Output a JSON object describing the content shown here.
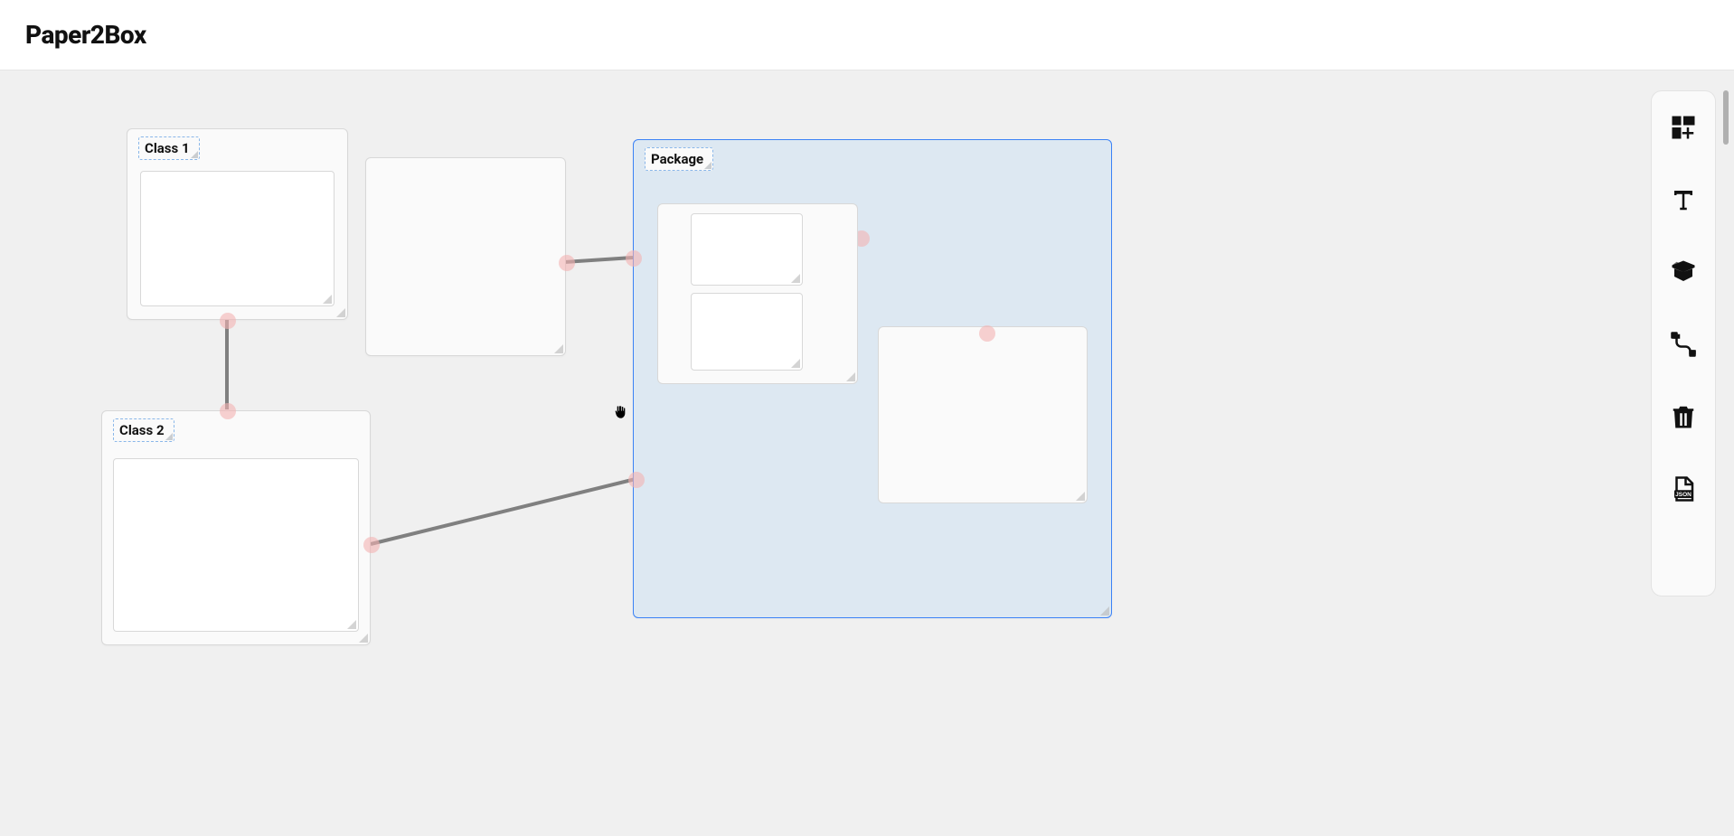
{
  "header": {
    "title": "Paper2Box"
  },
  "nodes": {
    "class1": {
      "label": "Class 1"
    },
    "class2": {
      "label": "Class 2"
    },
    "package": {
      "label": "Package"
    }
  },
  "toolbar": {
    "items": [
      {
        "name": "add-widget-tool",
        "icon": "widgets-add-icon"
      },
      {
        "name": "text-tool",
        "icon": "text-icon"
      },
      {
        "name": "package-tool",
        "icon": "open-box-icon"
      },
      {
        "name": "connector-tool",
        "icon": "cable-icon"
      },
      {
        "name": "delete-tool",
        "icon": "trash-icon"
      },
      {
        "name": "export-json-tool",
        "icon": "json-file-icon"
      }
    ]
  }
}
